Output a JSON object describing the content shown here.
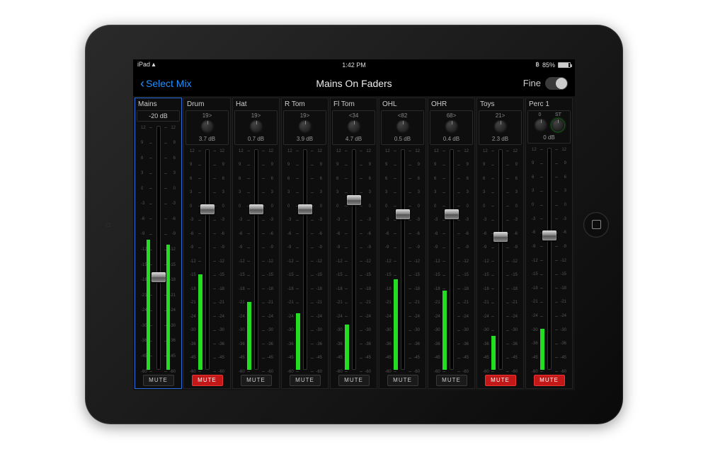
{
  "statusbar": {
    "device": "iPad",
    "time": "1:42 PM",
    "battery_pct": "85%"
  },
  "nav": {
    "back_label": "Select Mix",
    "title": "Mains On Faders",
    "fine_label": "Fine"
  },
  "scale_labels": [
    "12",
    "9",
    "6",
    "3",
    "0",
    "-3",
    "-6",
    "-9",
    "-12",
    "-15",
    "-18",
    "-21",
    "-24",
    "-30",
    "-36",
    "-45",
    "-60"
  ],
  "master": {
    "name": "Mains",
    "db": "-20 dB",
    "fader_pos": 0.62,
    "meter_l": 0.52,
    "meter_r": 0.5,
    "mute_active": false,
    "mute_label": "MUTE"
  },
  "channels": [
    {
      "name": "Drum",
      "pan": "19>",
      "gain": "3.7 dB",
      "fader_pos": 0.28,
      "meter": 0.42,
      "mute_active": true,
      "mute_label": "MUTE"
    },
    {
      "name": "Hat",
      "pan": "19>",
      "gain": "0.7 dB",
      "fader_pos": 0.28,
      "meter": 0.3,
      "mute_active": false,
      "mute_label": "MUTE"
    },
    {
      "name": "R Tom",
      "pan": "19>",
      "gain": "3.9 dB",
      "fader_pos": 0.28,
      "meter": 0.25,
      "mute_active": false,
      "mute_label": "MUTE"
    },
    {
      "name": "Fl Tom",
      "pan": "<34",
      "gain": "4.7 dB",
      "fader_pos": 0.24,
      "meter": 0.2,
      "mute_active": false,
      "mute_label": "MUTE"
    },
    {
      "name": "OHL",
      "pan": "<82",
      "gain": "0.5 dB",
      "fader_pos": 0.3,
      "meter": 0.4,
      "mute_active": false,
      "mute_label": "MUTE"
    },
    {
      "name": "OHR",
      "pan": "68>",
      "gain": "0.4 dB",
      "fader_pos": 0.3,
      "meter": 0.35,
      "mute_active": false,
      "mute_label": "MUTE"
    },
    {
      "name": "Toys",
      "pan": "21>",
      "gain": "2.3 dB",
      "fader_pos": 0.4,
      "meter": 0.15,
      "mute_active": true,
      "mute_label": "MUTE"
    },
    {
      "name": "Perc 1",
      "pan_l": "0",
      "pan_r": "ST",
      "stereo": true,
      "gain": "0 dB",
      "fader_pos": 0.4,
      "meter": 0.18,
      "mute_active": true,
      "mute_label": "MUTE"
    }
  ]
}
